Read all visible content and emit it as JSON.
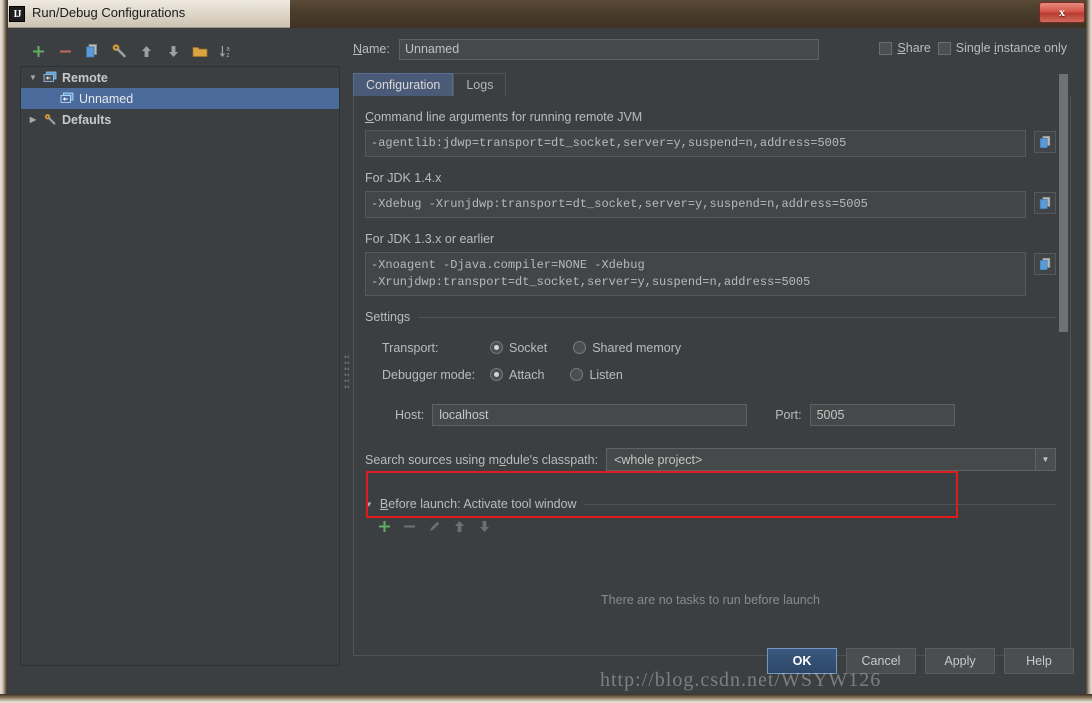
{
  "window": {
    "title": "Run/Debug Configurations",
    "app_icon": "IJ",
    "close_label": "x"
  },
  "left_panel": {
    "toolbar": [
      {
        "name": "add-button",
        "icon": "plus-icon",
        "label": "+"
      },
      {
        "name": "remove-button",
        "icon": "minus-icon",
        "label": "−"
      },
      {
        "name": "copy-configuration-button",
        "icon": "copy-icon",
        "label": ""
      },
      {
        "name": "edit-defaults-button",
        "icon": "wrench-icon",
        "label": ""
      },
      {
        "name": "move-up-button",
        "icon": "arrow-up-icon",
        "label": ""
      },
      {
        "name": "move-down-button",
        "icon": "arrow-down-icon",
        "label": ""
      },
      {
        "name": "create-folder-button",
        "icon": "folder-icon",
        "label": ""
      },
      {
        "name": "sort-alphabetically-button",
        "icon": "sort-az-icon",
        "label": ""
      }
    ],
    "tree": [
      {
        "label": "Remote",
        "icon": "remote-icon",
        "expanded": true,
        "level": 0,
        "selected": false,
        "bold": true,
        "arrow": "▼"
      },
      {
        "label": "Unnamed",
        "icon": "remote-icon",
        "expanded": false,
        "level": 1,
        "selected": true,
        "bold": false,
        "arrow": ""
      },
      {
        "label": "Defaults",
        "icon": "wrench-icon",
        "expanded": false,
        "level": 0,
        "selected": false,
        "bold": true,
        "arrow": "▶"
      }
    ]
  },
  "header": {
    "name_label": "Name:",
    "name_value": "Unnamed",
    "share_label": "Share",
    "share_checked": false,
    "single_instance_label": "Single instance only",
    "single_instance_checked": false
  },
  "tabs": [
    {
      "label": "Configuration",
      "active": true
    },
    {
      "label": "Logs",
      "active": false
    }
  ],
  "configuration": {
    "cmdline_label": "Command line arguments for running remote JVM",
    "cmdline_value": "-agentlib:jdwp=transport=dt_socket,server=y,suspend=n,address=5005",
    "jdk14_label": "For JDK 1.4.x",
    "jdk14_value": "-Xdebug -Xrunjdwp:transport=dt_socket,server=y,suspend=n,address=5005",
    "jdk13_label": "For JDK 1.3.x or earlier",
    "jdk13_value": "-Xnoagent -Djava.compiler=NONE -Xdebug\n-Xrunjdwp:transport=dt_socket,server=y,suspend=n,address=5005",
    "copy_button_title": "Copy to clipboard",
    "settings_title": "Settings",
    "transport_label": "Transport:",
    "transport_options": [
      {
        "label": "Socket",
        "selected": true
      },
      {
        "label": "Shared memory",
        "selected": false
      }
    ],
    "debugger_mode_label": "Debugger mode:",
    "debugger_mode_options": [
      {
        "label": "Attach",
        "selected": true
      },
      {
        "label": "Listen",
        "selected": false
      }
    ],
    "host_label": "Host:",
    "host_value": "localhost",
    "port_label": "Port:",
    "port_value": "5005",
    "classpath_label": "Search sources using module's classpath:",
    "classpath_value": "<whole project>",
    "classpath_arrow": "▼",
    "highlight_color": "#e01b1b"
  },
  "before_launch": {
    "arrow": "▼",
    "title": "Before launch: Activate tool window",
    "toolbar": [
      {
        "name": "add-task-button",
        "icon": "plus-icon",
        "enabled": true
      },
      {
        "name": "remove-task-button",
        "icon": "minus-icon",
        "enabled": false
      },
      {
        "name": "edit-task-button",
        "icon": "pencil-icon",
        "enabled": false
      },
      {
        "name": "move-task-up-button",
        "icon": "arrow-up-icon",
        "enabled": false
      },
      {
        "name": "move-task-down-button",
        "icon": "arrow-down-icon",
        "enabled": false
      }
    ],
    "empty_message": "There are no tasks to run before launch"
  },
  "footer": {
    "buttons": [
      {
        "label": "OK",
        "primary": true,
        "name": "ok-button"
      },
      {
        "label": "Cancel",
        "primary": false,
        "name": "cancel-button"
      },
      {
        "label": "Apply",
        "primary": false,
        "name": "apply-button"
      },
      {
        "label": "Help",
        "primary": false,
        "name": "help-button"
      }
    ]
  },
  "watermark": {
    "text": "http://blog.csdn.net/WSYW126"
  }
}
